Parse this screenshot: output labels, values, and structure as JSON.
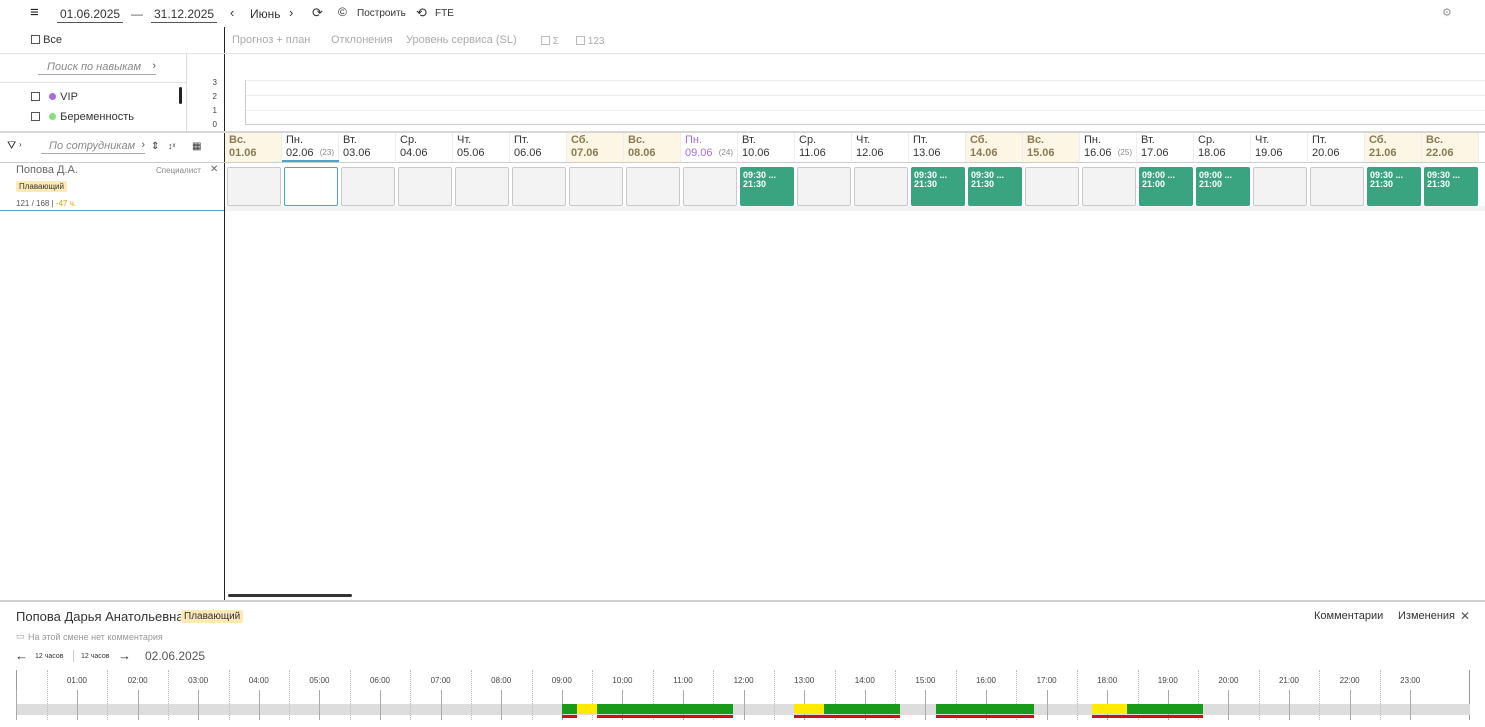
{
  "toolbar": {
    "date_from": "01.06.2025",
    "date_sep": "—",
    "date_to": "31.12.2025",
    "month": "Июнь",
    "build_label": "Построить",
    "fte_label": "FTE"
  },
  "filters": {
    "all_label": "Все",
    "skill_search_placeholder": "Поиск по навыкам",
    "skills": [
      {
        "label": "VIP",
        "color": "#a46ce0"
      },
      {
        "label": "Беременность",
        "color": "#86e07c"
      }
    ],
    "employee_search_placeholder": "По сотрудникам"
  },
  "chart_tabs": {
    "forecast": "Прогноз + план",
    "deviations": "Отклонения",
    "service_level": "Уровень сервиса (SL)",
    "sum_label": "Σ",
    "num_label": "123"
  },
  "mini_chart": {
    "yticks": [
      "3",
      "2",
      "1",
      "0"
    ]
  },
  "days": [
    {
      "dn": "Вс.",
      "dd": "01.06",
      "we": true
    },
    {
      "dn": "Пн.",
      "dd": "02.06",
      "wk": "(23)",
      "sel": true
    },
    {
      "dn": "Вт.",
      "dd": "03.06"
    },
    {
      "dn": "Ср.",
      "dd": "04.06"
    },
    {
      "dn": "Чт.",
      "dd": "05.06"
    },
    {
      "dn": "Пт.",
      "dd": "06.06"
    },
    {
      "dn": "Сб.",
      "dd": "07.06",
      "we": true
    },
    {
      "dn": "Вс.",
      "dd": "08.06",
      "we": true
    },
    {
      "dn": "Пн.",
      "dd": "09.06",
      "wk": "(24)",
      "purple": true
    },
    {
      "dn": "Вт.",
      "dd": "10.06"
    },
    {
      "dn": "Ср.",
      "dd": "11.06"
    },
    {
      "dn": "Чт.",
      "dd": "12.06"
    },
    {
      "dn": "Пт.",
      "dd": "13.06"
    },
    {
      "dn": "Сб.",
      "dd": "14.06",
      "we": true
    },
    {
      "dn": "Вс.",
      "dd": "15.06",
      "we": true
    },
    {
      "dn": "Пн.",
      "dd": "16.06",
      "wk": "(25)"
    },
    {
      "dn": "Вт.",
      "dd": "17.06"
    },
    {
      "dn": "Ср.",
      "dd": "18.06"
    },
    {
      "dn": "Чт.",
      "dd": "19.06"
    },
    {
      "dn": "Пт.",
      "dd": "20.06"
    },
    {
      "dn": "Сб.",
      "dd": "21.06",
      "we": true
    },
    {
      "dn": "Вс.",
      "dd": "22.06",
      "we": true
    }
  ],
  "employee": {
    "name": "Попова Д.А.",
    "role": "Специалист",
    "tag": "Плавающий",
    "hours": "121 / 168",
    "delta": "-47 ч."
  },
  "shifts": [
    {
      "idx": 9,
      "start": "09:30 ...",
      "end": "21:30"
    },
    {
      "idx": 12,
      "start": "09:30 ...",
      "end": "21:30"
    },
    {
      "idx": 13,
      "start": "09:30 ...",
      "end": "21:30"
    },
    {
      "idx": 16,
      "start": "09:00 ...",
      "end": "21:00"
    },
    {
      "idx": 17,
      "start": "09:00 ...",
      "end": "21:00"
    },
    {
      "idx": 20,
      "start": "09:30 ...",
      "end": "21:30"
    },
    {
      "idx": 21,
      "start": "09:30 ...",
      "end": "21:30"
    }
  ],
  "detail": {
    "full_name": "Попова Дарья Анатольевна",
    "tag": "Плавающий",
    "comments_label": "Комментарии",
    "changes_label": "Изменения",
    "no_comment": "На этой смене нет комментария",
    "prev_hours": "12 часов",
    "next_hours": "12 часов",
    "date": "02.06.2025"
  },
  "timeline_labels": [
    "01:00",
    "02:00",
    "03:00",
    "04:00",
    "05:00",
    "06:00",
    "07:00",
    "08:00",
    "09:00",
    "10:00",
    "11:00",
    "12:00",
    "13:00",
    "14:00",
    "15:00",
    "16:00",
    "17:00",
    "18:00",
    "19:00",
    "20:00",
    "21:00",
    "22:00",
    "23:00"
  ],
  "timeline_segments": [
    {
      "start": "09:00",
      "end": "09:15",
      "color": "#1a9a1a"
    },
    {
      "start": "09:15",
      "end": "09:35",
      "color": "#ffea00"
    },
    {
      "start": "09:35",
      "end": "11:50",
      "color": "#1a9a1a"
    },
    {
      "start": "12:50",
      "end": "13:20",
      "color": "#ffea00"
    },
    {
      "start": "13:20",
      "end": "14:35",
      "color": "#1a9a1a"
    },
    {
      "start": "15:10",
      "end": "16:48",
      "color": "#1a9a1a"
    },
    {
      "start": "17:45",
      "end": "18:20",
      "color": "#ffea00"
    },
    {
      "start": "18:20",
      "end": "19:35",
      "color": "#1a9a1a"
    }
  ],
  "timeline_red_segments": [
    {
      "start": "09:00",
      "end": "09:15"
    },
    {
      "start": "09:35",
      "end": "11:50"
    },
    {
      "start": "12:50",
      "end": "14:35"
    },
    {
      "start": "15:10",
      "end": "16:48"
    },
    {
      "start": "17:45",
      "end": "19:35"
    }
  ]
}
